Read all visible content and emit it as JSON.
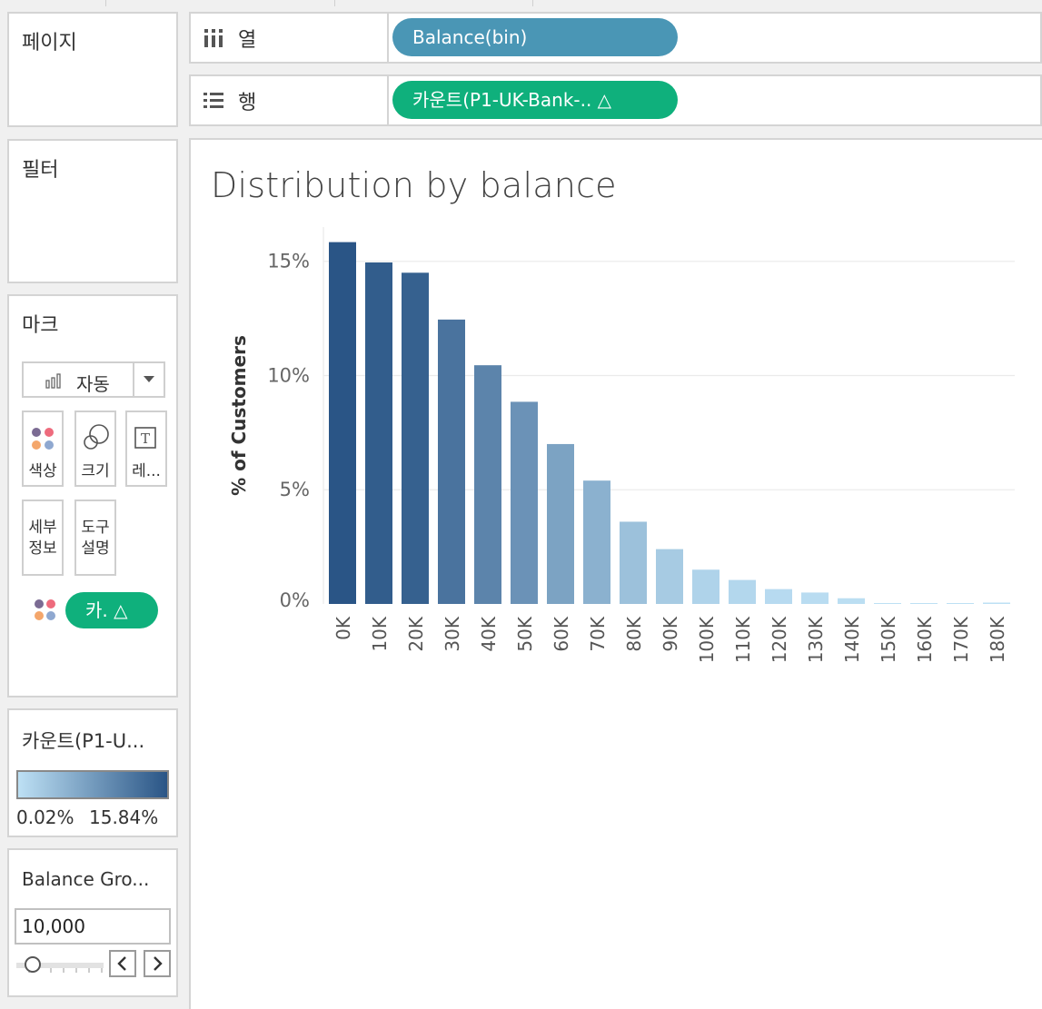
{
  "panels": {
    "pages": {
      "title": "페이지"
    },
    "filters": {
      "title": "필터"
    },
    "marks": {
      "title": "마크",
      "mark_type": "자동",
      "buttons": [
        {
          "label": "색상",
          "icon": "color-dots-icon"
        },
        {
          "label": "크기",
          "icon": "size-circles-icon"
        },
        {
          "label": "레...",
          "icon": "text-icon"
        },
        {
          "label": "세부\n정보",
          "icon": "detail-icon"
        },
        {
          "label": "도구\n설명",
          "icon": "tooltip-icon"
        }
      ],
      "color_pill": "카. △"
    },
    "color_legend": {
      "title": "카운트(P1-U...",
      "min_label": "0.02%",
      "max_label": "15.84%",
      "colors": [
        "#bde0f4",
        "#2a5586"
      ]
    },
    "parameter": {
      "title": "Balance Gro...",
      "value": "10,000",
      "slider_level": 0.15
    }
  },
  "shelves": {
    "columns": {
      "label": "열",
      "pill": "Balance(bin)",
      "pill_color": "#4a96b5"
    },
    "rows": {
      "label": "행",
      "pill": "카운트(P1-UK-Bank-..  △",
      "pill_color": "#0fb07c"
    }
  },
  "chart_data": {
    "type": "bar",
    "title": "Distribution by balance",
    "ylabel": "% of Customers",
    "xlabel": "",
    "categories": [
      "0K",
      "10K",
      "20K",
      "30K",
      "40K",
      "50K",
      "60K",
      "70K",
      "80K",
      "90K",
      "100K",
      "110K",
      "120K",
      "130K",
      "140K",
      "150K",
      "160K",
      "170K",
      "180K"
    ],
    "values": [
      15.84,
      14.95,
      14.5,
      12.45,
      10.45,
      8.85,
      7.0,
      5.4,
      3.6,
      2.4,
      1.5,
      1.05,
      0.65,
      0.5,
      0.25,
      0.04,
      0.03,
      0.02,
      0.06
    ],
    "ylim": [
      0,
      16.5
    ],
    "yticks": [
      0,
      5,
      10,
      15
    ],
    "ytick_labels": [
      "0%",
      "5%",
      "10%",
      "15%"
    ],
    "color_scale": [
      "#bde0f4",
      "#2a5586"
    ],
    "grid": true,
    "legend": "none"
  }
}
